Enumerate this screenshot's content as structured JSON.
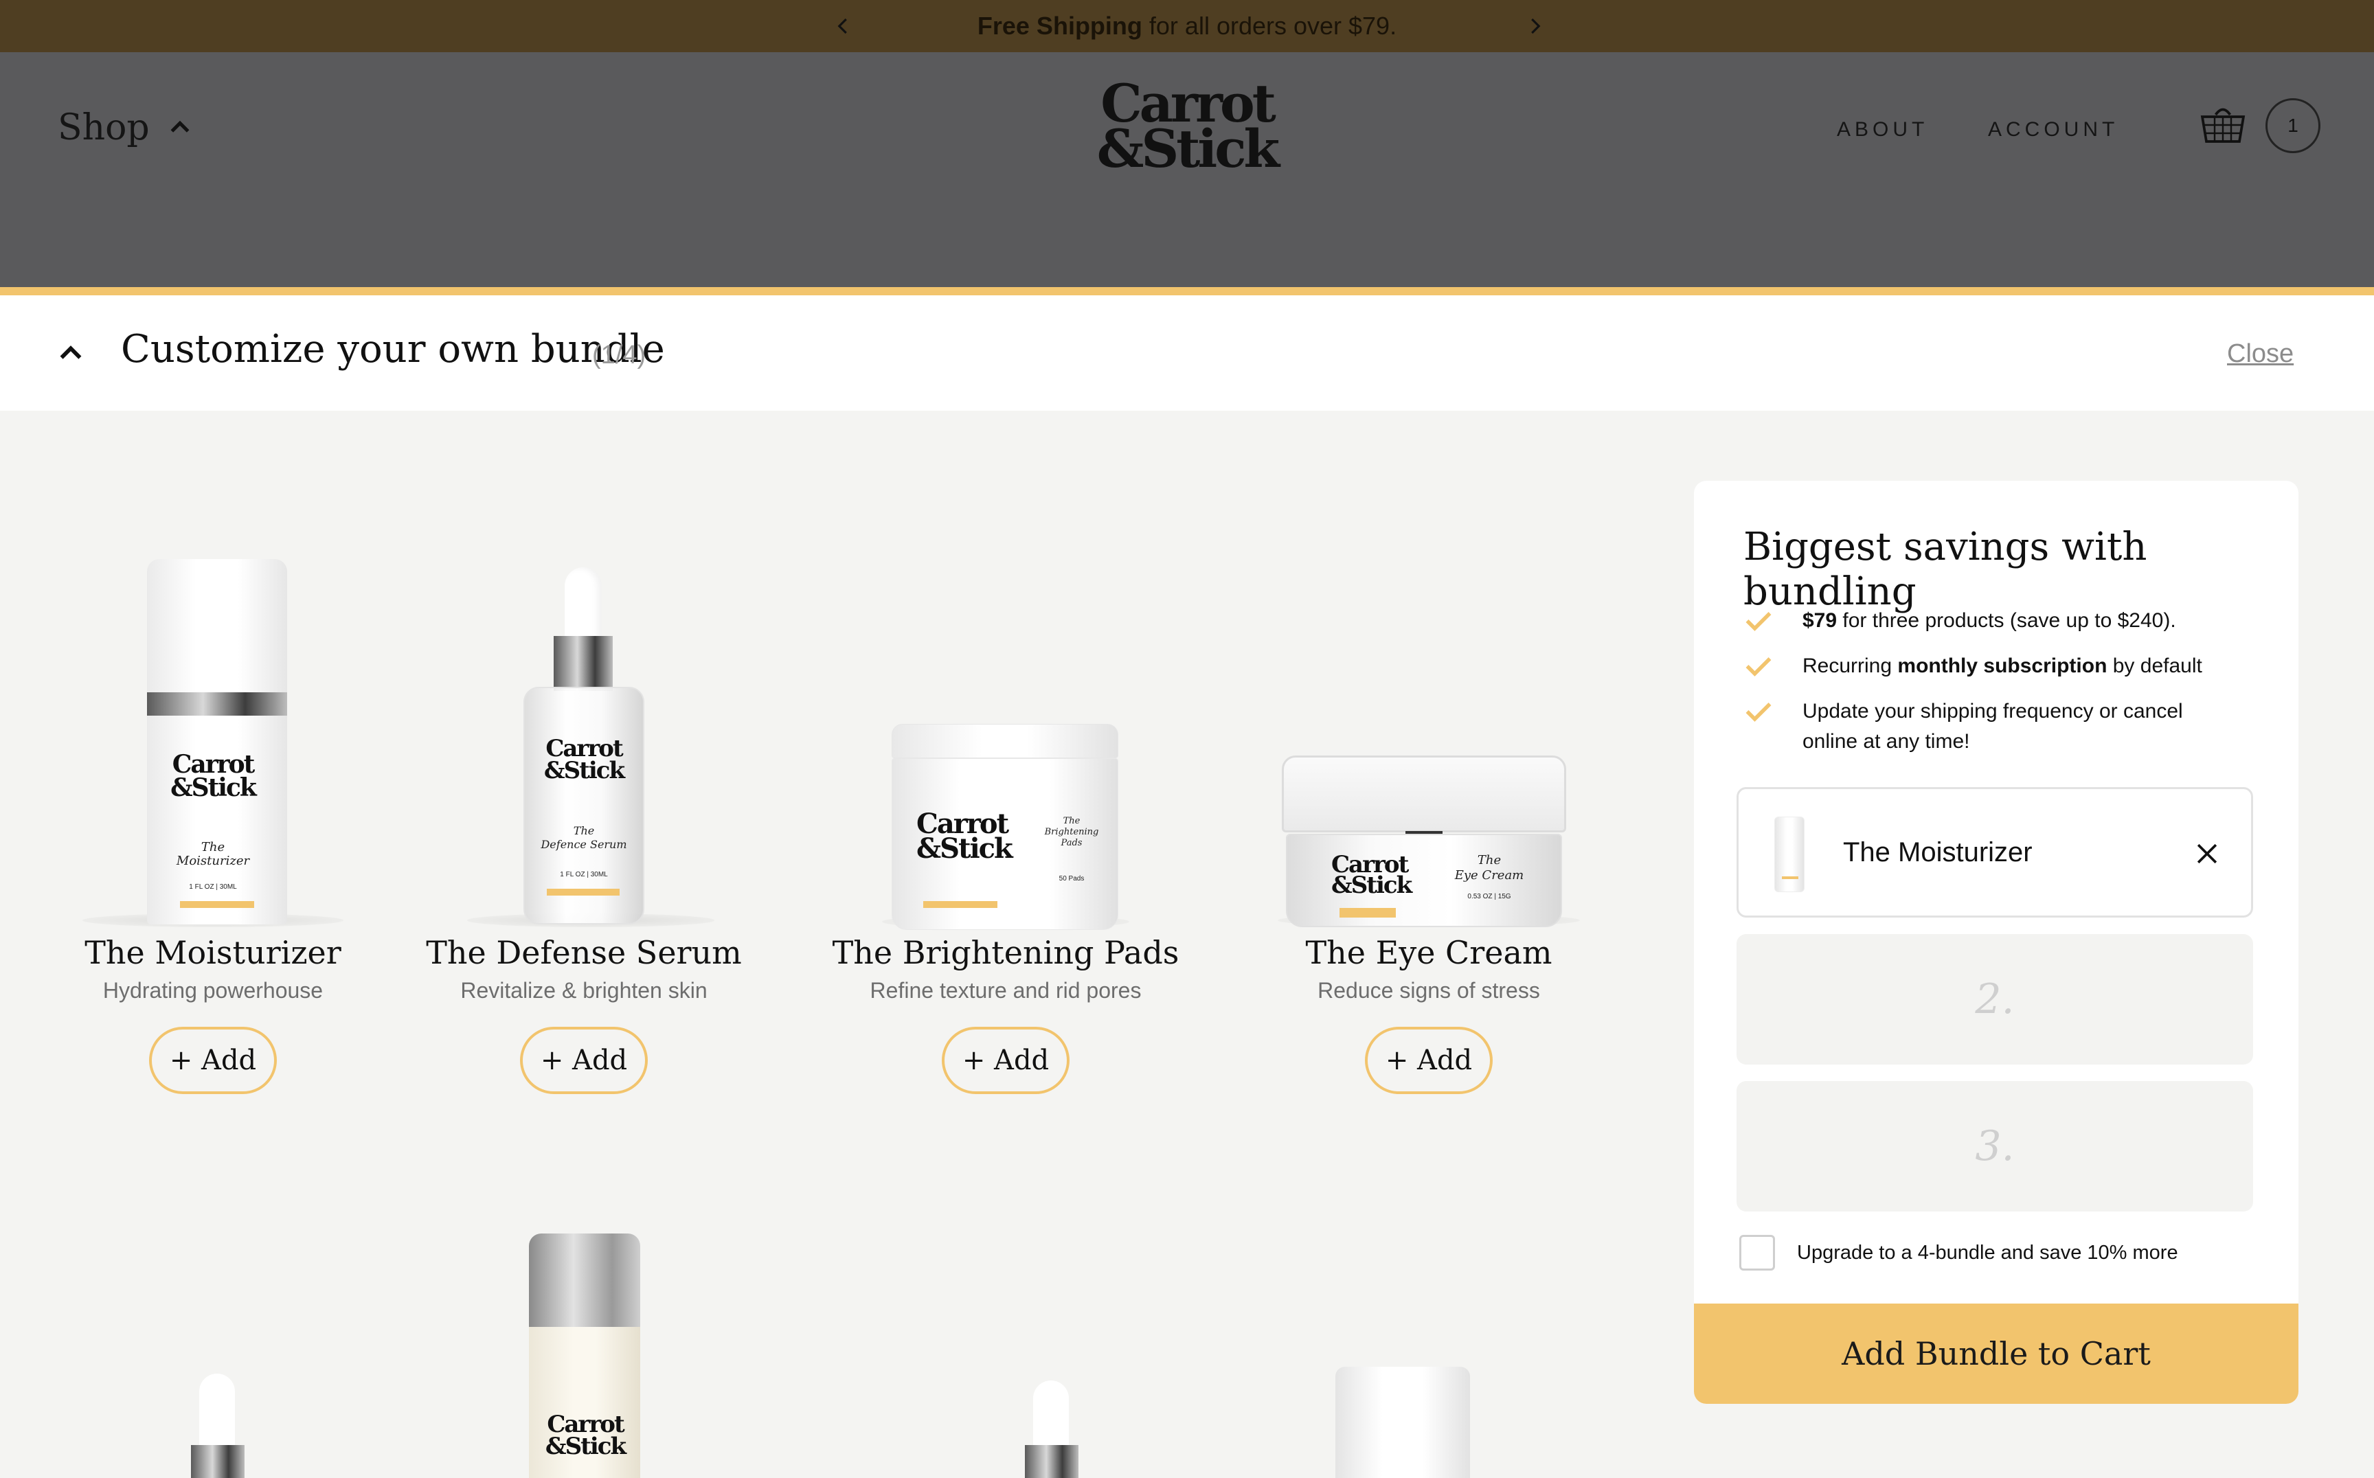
{
  "announcement": {
    "bold": "Free Shipping",
    "rest": " for all orders over $79.",
    "prev_icon": "chevron-left-icon",
    "next_icon": "chevron-right-icon"
  },
  "header": {
    "shop_label": "Shop",
    "logo_line1": "Carrot",
    "logo_line2": "&Stick",
    "about": "ABOUT",
    "account": "ACCOUNT",
    "cart_count": "1",
    "cart_icon": "basket-icon"
  },
  "bundle_bar": {
    "title": "Customize your own bundle",
    "count": "(1/4)",
    "close": "Close"
  },
  "label_text": {
    "brand_line1": "Carrot",
    "brand_line2": "&Stick",
    "moisturizer_the": "The",
    "moisturizer_name": "Moisturizer",
    "moisturizer_size": "1 FL OZ | 30ML",
    "serum_the": "The",
    "serum_name": "Defence Serum",
    "serum_size": "1 FL OZ | 30ML",
    "pads_the": "The",
    "pads_name": "Brightening Pads",
    "pads_count": "50 Pads",
    "eye_the": "The",
    "eye_name": "Eye Cream",
    "eye_size": "0.53 OZ | 15G"
  },
  "products": [
    {
      "name": "The Moisturizer",
      "desc": "Hydrating powerhouse",
      "add": "+ Add"
    },
    {
      "name": "The Defense Serum",
      "desc": "Revitalize & brighten skin",
      "add": "+ Add"
    },
    {
      "name": "The Brightening Pads",
      "desc": "Refine texture and rid pores",
      "add": "+ Add"
    },
    {
      "name": "The Eye Cream",
      "desc": "Reduce signs of stress",
      "add": "+ Add"
    }
  ],
  "panel": {
    "title": "Biggest savings with bundling",
    "benefits": [
      {
        "bold": "$79",
        "text": " for three products (save up to $240)."
      },
      {
        "pre": "Recurring ",
        "bold": "monthly subscription",
        "text": " by default"
      },
      {
        "text": "Update your shipping frequency or cancel online at any time!"
      }
    ],
    "slot1_name": "The Moisturizer",
    "slot2": "2.",
    "slot3": "3.",
    "upgrade": "Upgrade to a 4-bundle and save 10% more",
    "cta": "Add Bundle to Cart"
  },
  "colors": {
    "accent": "#f2c46d",
    "announcement_bg": "#4f3e22",
    "header_overlay": "#5a5a5c",
    "page_bg": "#f4f4f2"
  }
}
